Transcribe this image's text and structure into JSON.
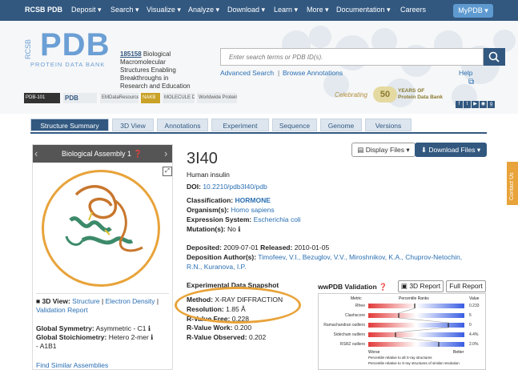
{
  "nav": {
    "items": [
      "RCSB PDB",
      "Deposit",
      "Search",
      "Visualize",
      "Analyze",
      "Download",
      "Learn",
      "More",
      "Documentation",
      "Careers"
    ],
    "mypdb": "MyPDB"
  },
  "header": {
    "logo_text": "PDB",
    "logo_rcsb": "RCSB",
    "logo_sub": "PROTEIN DATA BANK",
    "tagline_count": "185158",
    "tagline_text": " Biological Macromolecular Structures Enabling Breakthroughs in Research and Education",
    "search_placeholder": "Enter search terms or PDB ID(s).",
    "advanced_search": "Advanced Search",
    "browse_annotations": "Browse Annotations",
    "help": "Help",
    "celebrating": "Celebrating",
    "years_num": "50",
    "years_line1": "YEARS OF",
    "years_line2": "Protein Data Bank",
    "partners": [
      "PDB-101",
      "PDB",
      "EMDataResource",
      "NAKB",
      "MOLECULE DATA BANK",
      "Worldwide Protein Data Bank Foundation"
    ]
  },
  "tabs": [
    "Structure Summary",
    "3D View",
    "Annotations",
    "Experiment",
    "Sequence",
    "Genome",
    "Versions"
  ],
  "assembly": {
    "title": "Biological Assembly 1",
    "view_label": "3D View:",
    "view_links": [
      "Structure",
      "Electron Density",
      "Validation Report"
    ],
    "global_symmetry_label": "Global Symmetry:",
    "global_symmetry_value": "Asymmetric - C1",
    "global_stoich_label": "Global Stoichiometry:",
    "global_stoich_value": "Hetero 2-mer",
    "global_stoich_value2": "- A1B1",
    "find_similar": "Find Similar Assemblies"
  },
  "entry": {
    "id": "3I40",
    "name": "Human insulin",
    "doi_label": "DOI:",
    "doi": "10.2210/pdb3I40/pdb",
    "classification_label": "Classification:",
    "classification": "HORMONE",
    "organism_label": "Organism(s):",
    "organism": "Homo sapiens",
    "expression_label": "Expression System:",
    "expression": "Escherichia coli",
    "mutation_label": "Mutation(s):",
    "mutation": "No",
    "deposited_label": "Deposited:",
    "deposited": "2009-07-01",
    "released_label": "Released:",
    "released": "2010-01-05",
    "authors_label": "Deposition Author(s):",
    "authors_line1": "Timofeev, V.I., Bezuglov, V.V., Miroshnikov, K.A., Chuprov-Netochin,",
    "authors_line2": "R.N., Kuranova, I.P.",
    "display_files": "Display Files",
    "download_files": "Download Files"
  },
  "experiment": {
    "heading": "Experimental Data Snapshot",
    "method_label": "Method:",
    "method": "X-RAY DIFFRACTION",
    "resolution_label": "Resolution:",
    "resolution": "1.85 Å",
    "rfree_label": "R-Value Free:",
    "rfree": "0.228",
    "rwork_label": "R-Value Work:",
    "rwork": "0.200",
    "robs_label": "R-Value Observed:",
    "robs": "0.202"
  },
  "validation": {
    "heading": "wwPDB Validation",
    "btn_3d": "3D Report",
    "btn_full": "Full Report",
    "col_metric": "Metric",
    "col_ranks": "Percentile Ranks",
    "col_value": "Value",
    "rows": [
      {
        "metric": "Rfree",
        "value": "0.233"
      },
      {
        "metric": "Clashscore",
        "value": "5"
      },
      {
        "metric": "Ramachandran outliers",
        "value": "0"
      },
      {
        "metric": "Sidechain outliers",
        "value": "4.4%"
      },
      {
        "metric": "RSRZ outliers",
        "value": "2.0%"
      }
    ],
    "worse": "Worse",
    "better": "Better",
    "legend1": "Percentile relative to all X-ray structures",
    "legend2": "Percentile relative to X-ray structures of similar resolution"
  },
  "contact": "Contact Us",
  "colors": {
    "nav": "#325880",
    "accent": "#e8a33a",
    "link": "#2a6fb3"
  }
}
